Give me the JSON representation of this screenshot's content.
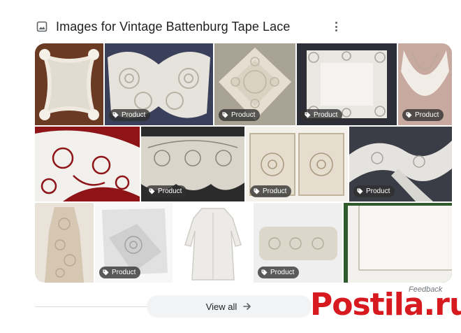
{
  "header": {
    "title": "Images for Vintage Battenburg Tape Lace",
    "image_icon": "image-icon",
    "more_icon": "more-vert-icon"
  },
  "tiles": [
    {
      "badge": ""
    },
    {
      "badge": "Product"
    },
    {
      "badge": "Product"
    },
    {
      "badge": "Product"
    },
    {
      "badge": "Product"
    },
    {
      "badge": ""
    },
    {
      "badge": "Product"
    },
    {
      "badge": "Product"
    },
    {
      "badge": "Product"
    },
    {
      "badge": ""
    },
    {
      "badge": "Product"
    },
    {
      "badge": ""
    },
    {
      "badge": "Product"
    },
    {
      "badge": ""
    }
  ],
  "feedback": "Feedback",
  "view_all": {
    "label": "View all",
    "icon": "arrow-right-icon"
  },
  "watermark": {
    "text": "Postila.ru",
    "icon": "postila-logo-icon"
  },
  "colors": {
    "badge_bg": "#303030",
    "watermark_red": "#d71920",
    "button_bg": "#f1f3f4"
  }
}
